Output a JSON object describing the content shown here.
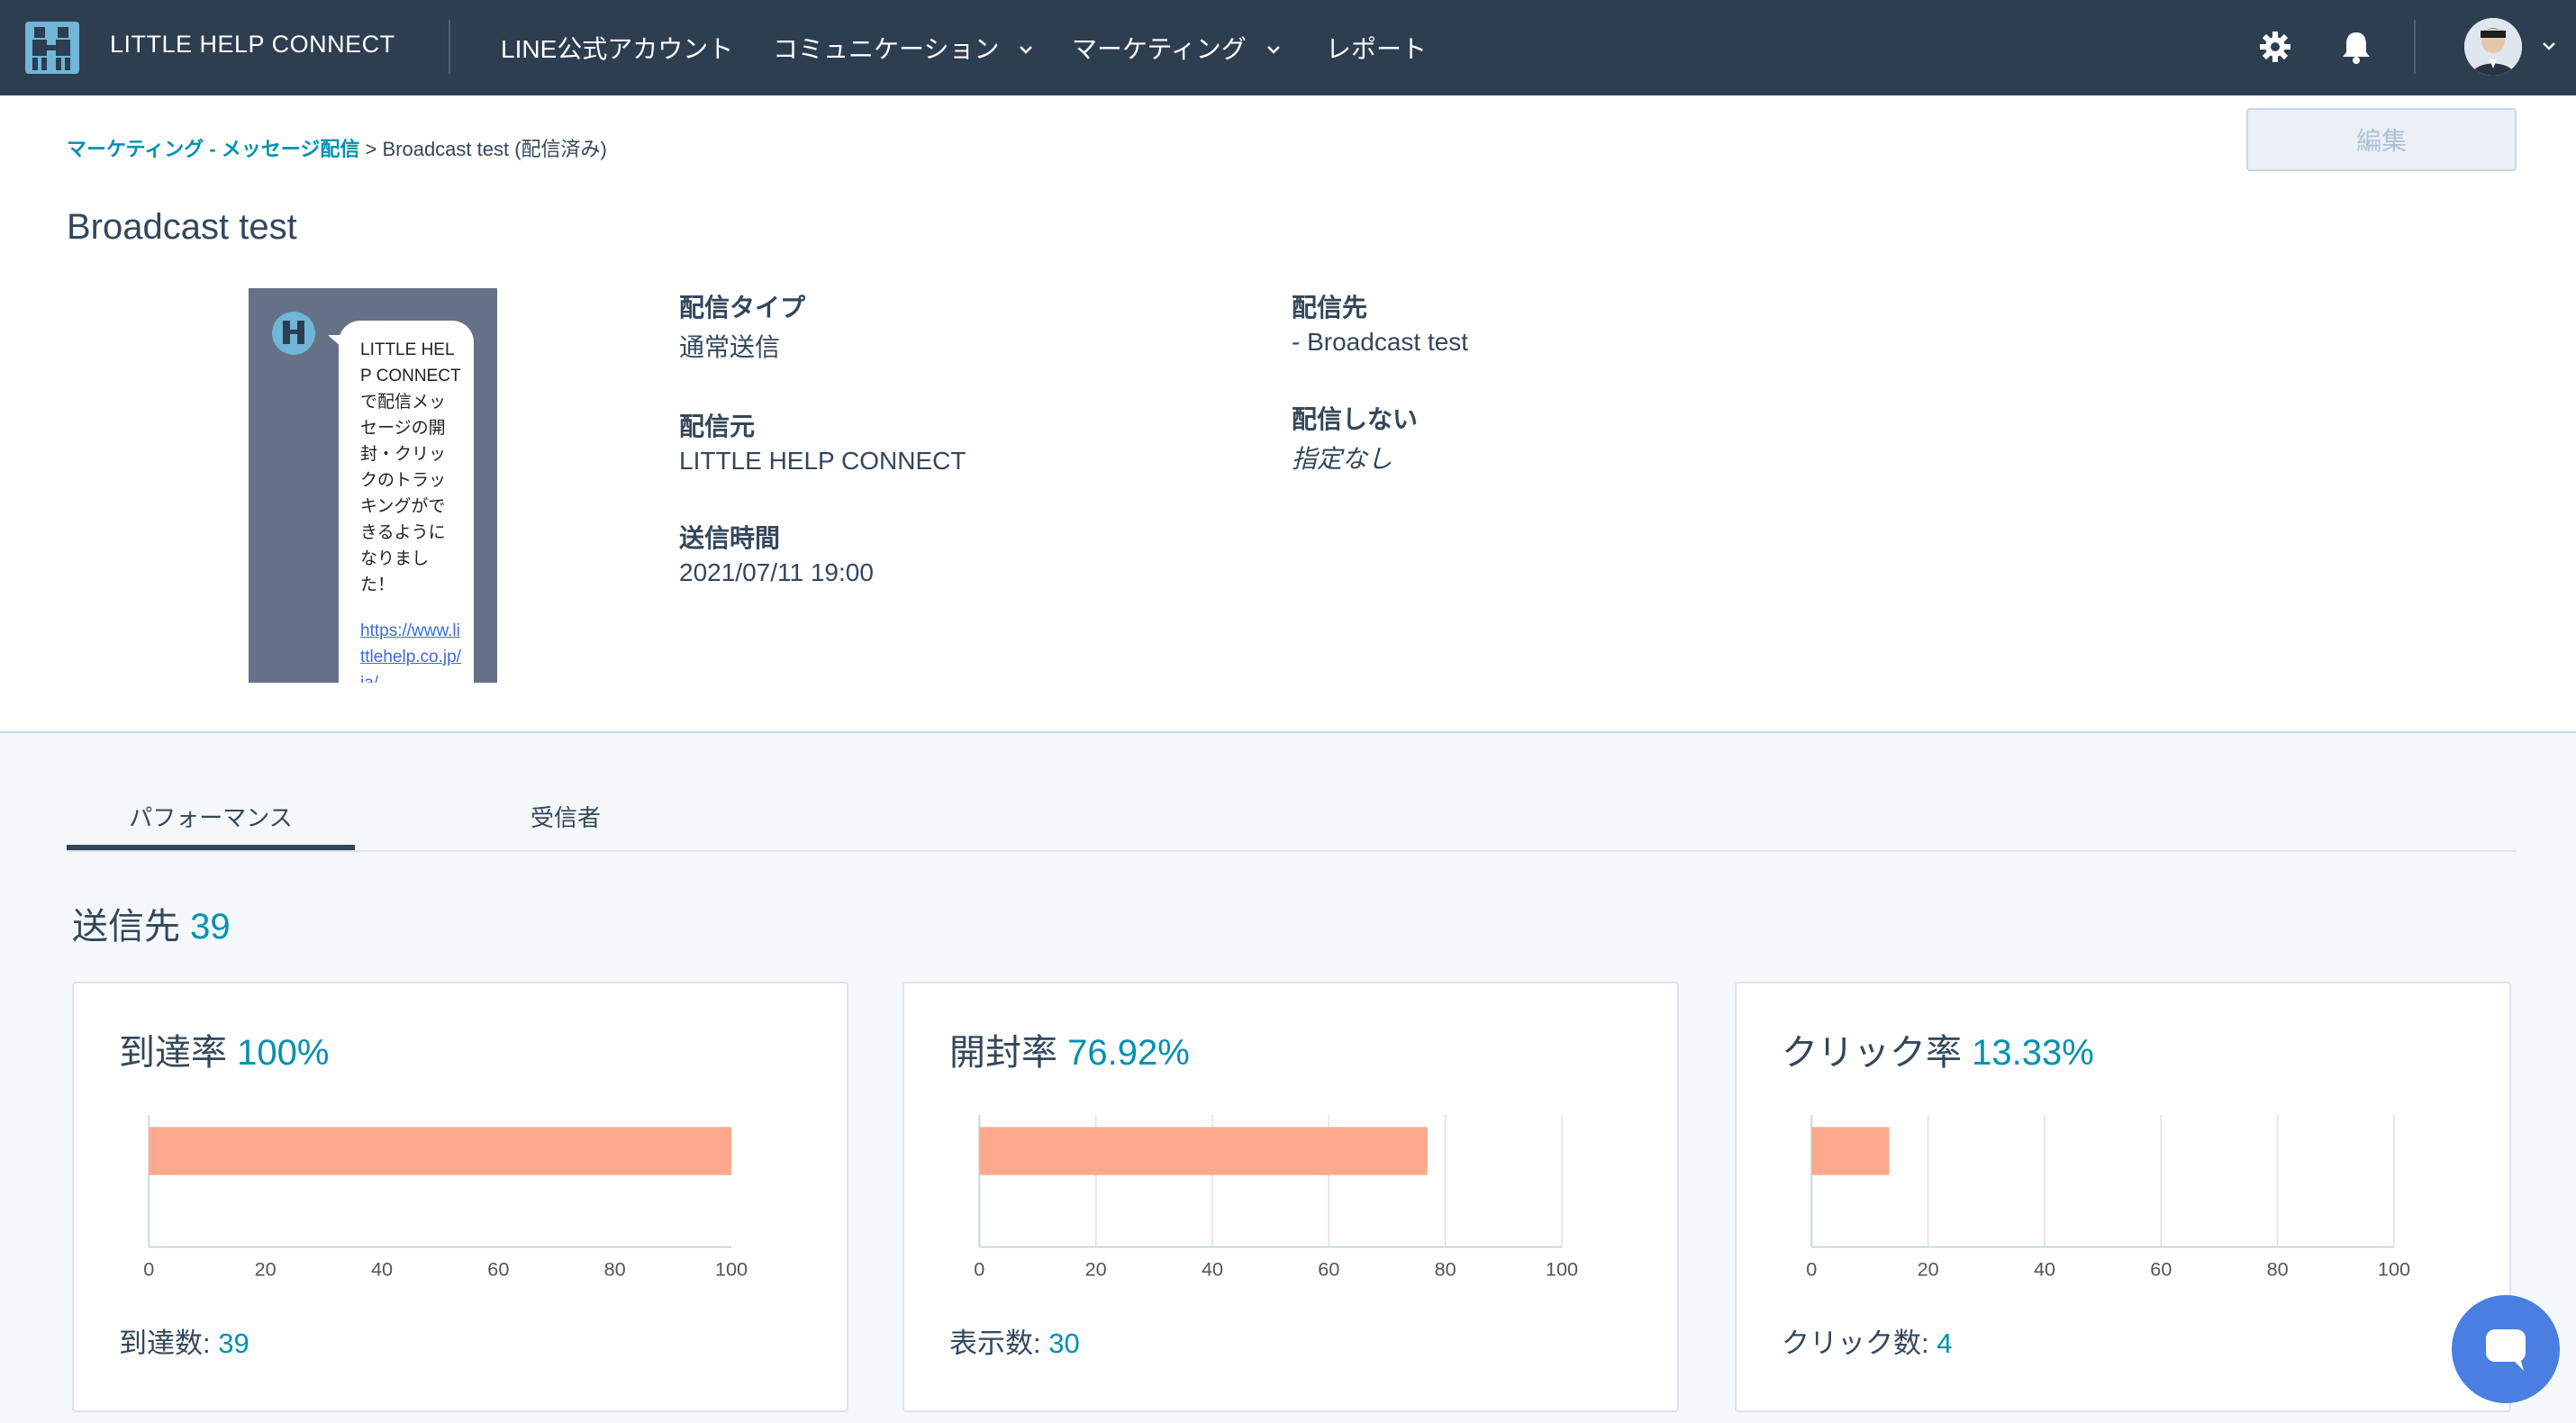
{
  "topbar": {
    "brand": "LITTLE HELP CONNECT",
    "nav": [
      {
        "label": "LINE公式アカウント",
        "has_dropdown": false
      },
      {
        "label": "コミュニケーション",
        "has_dropdown": true
      },
      {
        "label": "マーケティング",
        "has_dropdown": true
      },
      {
        "label": "レポート",
        "has_dropdown": false
      }
    ],
    "icons": [
      "gear-icon",
      "bell-icon",
      "chevron-down-icon"
    ],
    "bg_color": "#2d3e50"
  },
  "breadcrumb": {
    "link": "マーケティング - メッセージ配信",
    "separator": ">",
    "current": "Broadcast test (配信済み)"
  },
  "edit_label": "編集",
  "page_title": "Broadcast test",
  "preview": {
    "message": "LITTLE HELP CONNECTで配信メッセージの開封・クリックのトラッキングができるようになりました！",
    "link": "https://www.littlehelp.co.jp/ja/"
  },
  "meta": {
    "delivery_type_label": "配信タイプ",
    "delivery_type_value": "通常送信",
    "sender_label": "配信元",
    "sender_value": "LITTLE HELP CONNECT",
    "send_time_label": "送信時間",
    "send_time_value": "2021/07/11 19:00",
    "target_label": "配信先",
    "target_value": "- Broadcast test",
    "exclude_label": "配信しない",
    "exclude_value": "指定なし"
  },
  "tabs": [
    {
      "label": "パフォーマンス",
      "active": true
    },
    {
      "label": "受信者",
      "active": false
    }
  ],
  "summary": {
    "label": "送信先",
    "value": "39"
  },
  "colors": {
    "accent": "#0091ae",
    "bar": "#ffa98d",
    "text": "#33475b"
  },
  "chart_data": [
    {
      "type": "bar",
      "orientation": "horizontal",
      "title": "到達率",
      "title_value": "100%",
      "values": [
        100
      ],
      "xlim": [
        0,
        100
      ],
      "ticks": [
        "0",
        "20",
        "40",
        "60",
        "80",
        "100"
      ],
      "grid": false,
      "footer_label": "到達数:",
      "footer_value": "39"
    },
    {
      "type": "bar",
      "orientation": "horizontal",
      "title": "開封率",
      "title_value": "76.92%",
      "values": [
        76.92
      ],
      "xlim": [
        0,
        100
      ],
      "ticks": [
        "0",
        "20",
        "40",
        "60",
        "80",
        "100"
      ],
      "grid": true,
      "footer_label": "表示数:",
      "footer_value": "30"
    },
    {
      "type": "bar",
      "orientation": "horizontal",
      "title": "クリック率",
      "title_value": "13.33%",
      "values": [
        13.33
      ],
      "xlim": [
        0,
        100
      ],
      "ticks": [
        "0",
        "20",
        "40",
        "60",
        "80",
        "100"
      ],
      "grid": true,
      "footer_label": "クリック数:",
      "footer_value": "4"
    }
  ]
}
